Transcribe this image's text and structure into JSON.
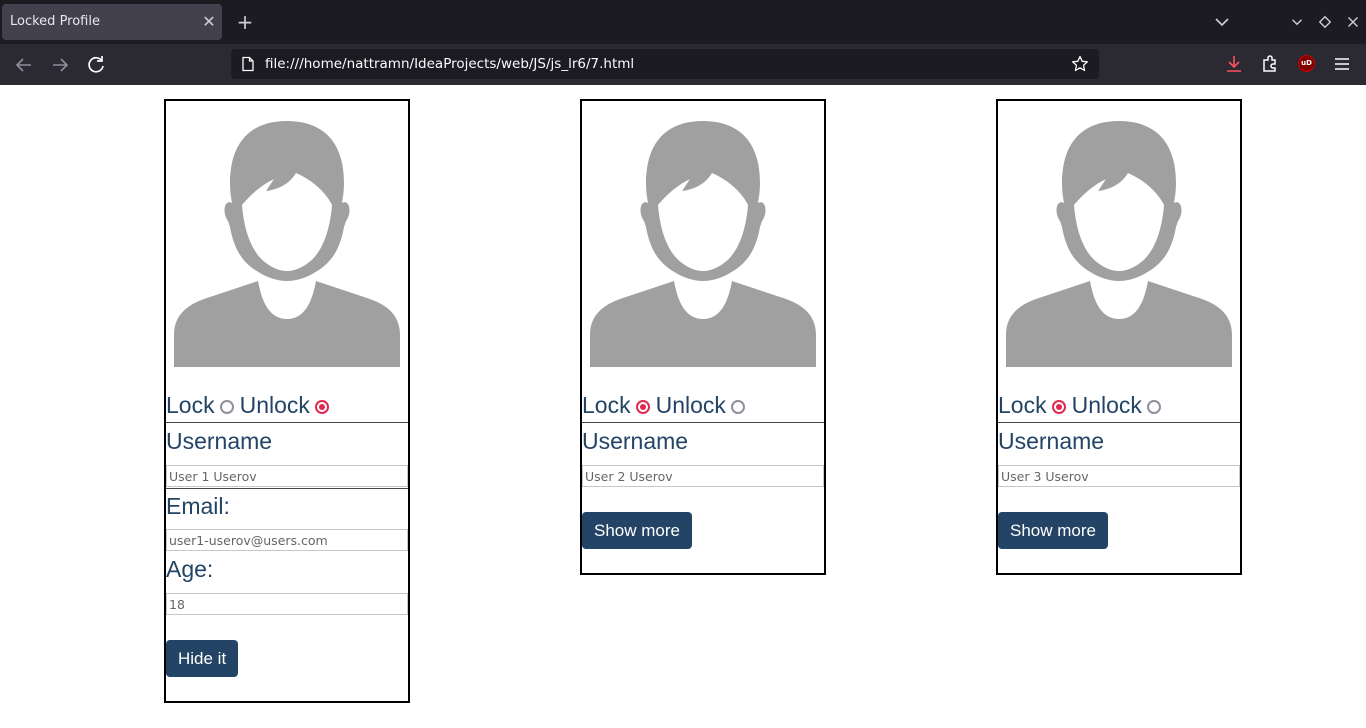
{
  "browser": {
    "tab_title": "Locked Profile",
    "url": "file:///home/nattramn/IdeaProjects/web/JS/js_lr6/7.html",
    "ublock_label": "uD"
  },
  "profiles": [
    {
      "lock_label": "Lock",
      "unlock_label": "Unlock",
      "selected": "unlock",
      "username_label": "Username",
      "username_value": "User 1 Userov",
      "expanded": true,
      "email_label": "Email:",
      "email_value": "user1-userov@users.com",
      "age_label": "Age:",
      "age_value": "18",
      "button_label": "Hide it"
    },
    {
      "lock_label": "Lock",
      "unlock_label": "Unlock",
      "selected": "lock",
      "username_label": "Username",
      "username_value": "User 2 Userov",
      "expanded": false,
      "button_label": "Show more"
    },
    {
      "lock_label": "Lock",
      "unlock_label": "Unlock",
      "selected": "lock",
      "username_label": "Username",
      "username_value": "User 3 Userov",
      "expanded": false,
      "button_label": "Show more"
    }
  ],
  "colors": {
    "accent": "#234465",
    "radio_checked": "#e22850",
    "avatar": "#a0a0a0"
  }
}
